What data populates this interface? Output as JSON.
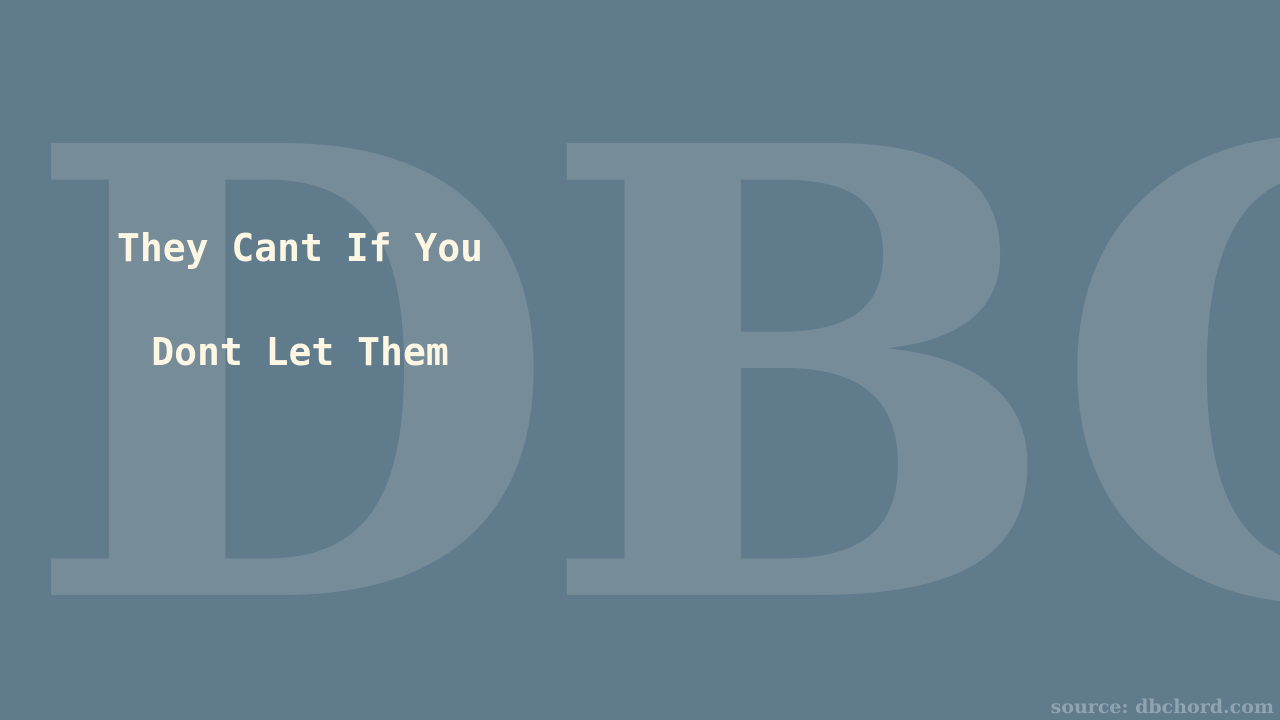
{
  "watermark": {
    "text": "DBC"
  },
  "title": {
    "line1": "They Cant If You",
    "line2": "Dont Let Them"
  },
  "source": {
    "text": "source: dbchord.com"
  },
  "colors": {
    "background": "#5f7b8c",
    "watermark": "#768c99",
    "title_text": "#fdf6e3",
    "source_text": "#8fa3b0"
  }
}
